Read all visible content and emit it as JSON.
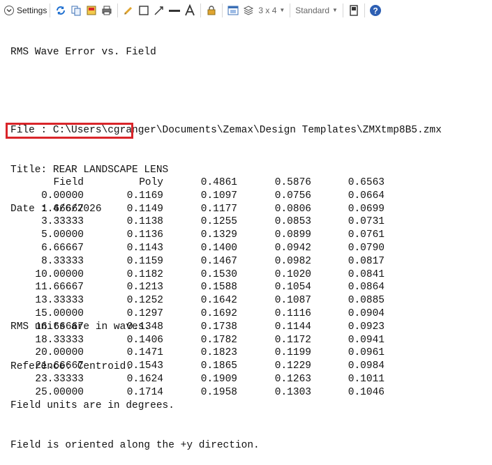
{
  "toolbar": {
    "settings_label": "Settings",
    "layout_label": "3 x 4",
    "style_label": "Standard"
  },
  "report": {
    "title": "RMS Wave Error vs. Field",
    "file_line": "File : C:\\Users\\cgranger\\Documents\\Zemax\\Design Templates\\ZMXtmp8B5.zmx",
    "title_line": "Title: REAR LANDSCAPE LENS",
    "date_line": "Date : 4/6/2026",
    "units_line": "RMS units are in waves.",
    "reference_line": "Reference: Centroid.",
    "field_units_line": "Field units are in degrees.",
    "orientation_line": "Field is oriented along the +y direction."
  },
  "table": {
    "headers": [
      "Field",
      "Poly",
      "0.4861",
      "0.5876",
      "0.6563"
    ],
    "rows": [
      [
        "0.00000",
        "0.1169",
        "0.1097",
        "0.0756",
        "0.0664"
      ],
      [
        "1.66667",
        "0.1149",
        "0.1177",
        "0.0806",
        "0.0699"
      ],
      [
        "3.33333",
        "0.1138",
        "0.1255",
        "0.0853",
        "0.0731"
      ],
      [
        "5.00000",
        "0.1136",
        "0.1329",
        "0.0899",
        "0.0761"
      ],
      [
        "6.66667",
        "0.1143",
        "0.1400",
        "0.0942",
        "0.0790"
      ],
      [
        "8.33333",
        "0.1159",
        "0.1467",
        "0.0982",
        "0.0817"
      ],
      [
        "10.00000",
        "0.1182",
        "0.1530",
        "0.1020",
        "0.0841"
      ],
      [
        "11.66667",
        "0.1213",
        "0.1588",
        "0.1054",
        "0.0864"
      ],
      [
        "13.33333",
        "0.1252",
        "0.1642",
        "0.1087",
        "0.0885"
      ],
      [
        "15.00000",
        "0.1297",
        "0.1692",
        "0.1116",
        "0.0904"
      ],
      [
        "16.66667",
        "0.1348",
        "0.1738",
        "0.1144",
        "0.0923"
      ],
      [
        "18.33333",
        "0.1406",
        "0.1782",
        "0.1172",
        "0.0941"
      ],
      [
        "20.00000",
        "0.1471",
        "0.1823",
        "0.1199",
        "0.0961"
      ],
      [
        "21.66667",
        "0.1543",
        "0.1865",
        "0.1229",
        "0.0984"
      ],
      [
        "23.33333",
        "0.1624",
        "0.1909",
        "0.1263",
        "0.1011"
      ],
      [
        "25.00000",
        "0.1714",
        "0.1958",
        "0.1303",
        "0.1046"
      ]
    ]
  },
  "highlight_color": "#d9252a"
}
